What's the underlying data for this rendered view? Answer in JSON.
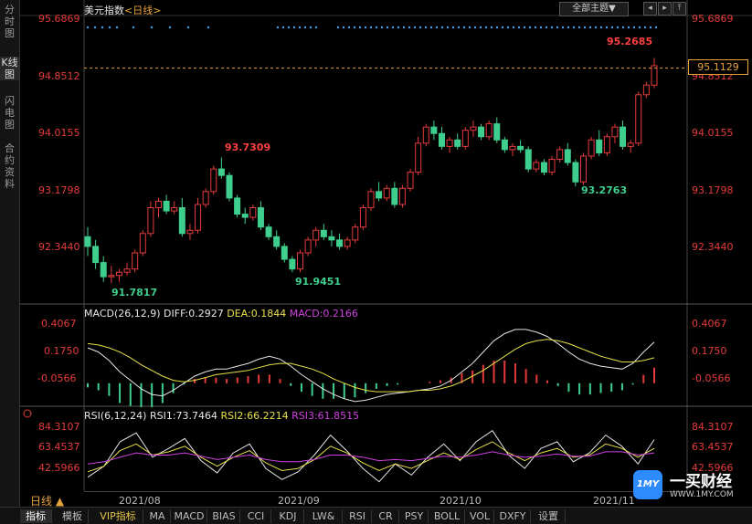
{
  "sidebar": {
    "items": [
      {
        "label": "分时图"
      },
      {
        "label": "K线图"
      },
      {
        "label": "闪电图"
      },
      {
        "label": "合约资料"
      }
    ]
  },
  "header": {
    "name": "美元指数",
    "period_tag": "<日线>",
    "theme_button": "全部主题▼",
    "win_buttons": [
      "◂",
      "▸",
      "⤒"
    ]
  },
  "main_chart": {
    "y_ticks": [
      "95.6869",
      "94.8512",
      "94.0155",
      "93.1798",
      "92.3440"
    ],
    "current_price": "95.1129",
    "annotations": {
      "high_recent": "95.2685",
      "peak_aug": "93.7309",
      "low_jul": "91.7817",
      "low_sep": "91.9451",
      "low_oct": "93.2763"
    }
  },
  "macd": {
    "label": "MACD(26,12,9)",
    "diff": "DIFF:0.2927",
    "dea": "DEA:0.1844",
    "macd": "MACD:0.2166",
    "y_ticks": [
      "0.4067",
      "0.1750",
      "-0.0566"
    ]
  },
  "rsi": {
    "label": "RSI(6,12,24)",
    "rsi1": "RSI1:73.7464",
    "rsi2": "RSI2:66.2214",
    "rsi3": "RSI3:61.8515",
    "y_ticks": [
      "84.3107",
      "63.4537",
      "42.5966"
    ]
  },
  "xaxis": {
    "labels": [
      "2021/08",
      "2021/09",
      "2021/10",
      "2021/11"
    ]
  },
  "period_label": "日线 ▲",
  "bottom_tabs": [
    "指标",
    "模板",
    "VIP指标",
    "MA",
    "MACD",
    "BIAS",
    "CCI",
    "KDJ",
    "LW&",
    "RSI",
    "CR",
    "PSY",
    "BOLL",
    "VOL",
    "DXFY",
    "设置"
  ],
  "logo": {
    "badge": "1MY",
    "text": "一买财经",
    "url": "WWW.1MY.COM"
  },
  "colors": {
    "up": "#e53b3b",
    "down": "#3ecf8e",
    "accent": "#e6a23c"
  },
  "chart_data": [
    {
      "type": "candlestick",
      "title": "美元指数 <日线>",
      "ylim": [
        91.5,
        95.9
      ],
      "x": [
        "2021/08",
        "2021/09",
        "2021/10",
        "2021/11"
      ],
      "candles": [
        [
          92.5,
          92.65,
          92.2,
          92.35
        ],
        [
          92.35,
          92.45,
          92.0,
          92.1
        ],
        [
          92.1,
          92.2,
          91.8,
          91.88
        ],
        [
          91.88,
          92.05,
          91.78,
          91.9
        ],
        [
          91.9,
          92.0,
          91.8,
          91.95
        ],
        [
          91.95,
          92.1,
          91.9,
          92.0
        ],
        [
          92.0,
          92.3,
          91.95,
          92.25
        ],
        [
          92.25,
          92.6,
          92.2,
          92.55
        ],
        [
          92.55,
          93.05,
          92.5,
          92.95
        ],
        [
          92.95,
          93.1,
          92.8,
          93.05
        ],
        [
          93.05,
          93.15,
          92.85,
          92.9
        ],
        [
          92.9,
          93.05,
          92.85,
          92.95
        ],
        [
          92.95,
          93.1,
          92.5,
          92.55
        ],
        [
          92.55,
          92.7,
          92.45,
          92.6
        ],
        [
          92.6,
          93.1,
          92.55,
          93.0
        ],
        [
          93.0,
          93.25,
          92.95,
          93.2
        ],
        [
          93.2,
          93.6,
          93.15,
          93.55
        ],
        [
          93.55,
          93.73,
          93.4,
          93.45
        ],
        [
          93.45,
          93.5,
          93.05,
          93.1
        ],
        [
          93.1,
          93.15,
          92.8,
          92.85
        ],
        [
          92.85,
          92.95,
          92.7,
          92.8
        ],
        [
          92.8,
          93.0,
          92.75,
          92.95
        ],
        [
          92.95,
          93.05,
          92.6,
          92.65
        ],
        [
          92.65,
          92.7,
          92.45,
          92.5
        ],
        [
          92.5,
          92.6,
          92.3,
          92.35
        ],
        [
          92.35,
          92.4,
          92.1,
          92.15
        ],
        [
          92.15,
          92.2,
          91.95,
          92.0
        ],
        [
          92.0,
          92.3,
          91.95,
          92.25
        ],
        [
          92.25,
          92.5,
          92.2,
          92.45
        ],
        [
          92.45,
          92.65,
          92.35,
          92.6
        ],
        [
          92.6,
          92.7,
          92.45,
          92.5
        ],
        [
          92.5,
          92.6,
          92.35,
          92.45
        ],
        [
          92.45,
          92.55,
          92.3,
          92.35
        ],
        [
          92.35,
          92.5,
          92.3,
          92.45
        ],
        [
          92.45,
          92.7,
          92.4,
          92.65
        ],
        [
          92.65,
          93.0,
          92.6,
          92.95
        ],
        [
          92.95,
          93.25,
          92.9,
          93.2
        ],
        [
          93.2,
          93.35,
          93.05,
          93.1
        ],
        [
          93.1,
          93.3,
          93.05,
          93.25
        ],
        [
          93.25,
          93.35,
          92.95,
          93.0
        ],
        [
          93.0,
          93.3,
          92.95,
          93.25
        ],
        [
          93.25,
          93.55,
          93.2,
          93.5
        ],
        [
          93.5,
          94.05,
          93.45,
          93.95
        ],
        [
          93.95,
          94.25,
          93.9,
          94.2
        ],
        [
          94.2,
          94.3,
          94.0,
          94.1
        ],
        [
          94.1,
          94.2,
          93.85,
          93.9
        ],
        [
          93.9,
          94.05,
          93.8,
          94.0
        ],
        [
          94.0,
          94.1,
          93.85,
          93.9
        ],
        [
          93.9,
          94.2,
          93.85,
          94.15
        ],
        [
          94.15,
          94.3,
          94.05,
          94.2
        ],
        [
          94.2,
          94.25,
          94.0,
          94.05
        ],
        [
          94.05,
          94.3,
          94.0,
          94.25
        ],
        [
          94.25,
          94.35,
          93.95,
          94.0
        ],
        [
          94.0,
          94.05,
          93.8,
          93.85
        ],
        [
          93.85,
          93.95,
          93.75,
          93.9
        ],
        [
          93.9,
          94.0,
          93.8,
          93.85
        ],
        [
          93.85,
          93.9,
          93.5,
          93.55
        ],
        [
          93.55,
          93.7,
          93.5,
          93.65
        ],
        [
          93.65,
          93.7,
          93.45,
          93.5
        ],
        [
          93.5,
          93.75,
          93.45,
          93.7
        ],
        [
          93.7,
          93.9,
          93.65,
          93.85
        ],
        [
          93.85,
          93.95,
          93.6,
          93.65
        ],
        [
          93.65,
          93.7,
          93.28,
          93.35
        ],
        [
          93.35,
          93.8,
          93.3,
          93.75
        ],
        [
          93.75,
          94.05,
          93.7,
          94.0
        ],
        [
          94.0,
          94.15,
          93.75,
          93.8
        ],
        [
          93.8,
          94.1,
          93.75,
          94.05
        ],
        [
          94.05,
          94.25,
          93.95,
          94.2
        ],
        [
          94.2,
          94.3,
          93.85,
          93.9
        ],
        [
          93.9,
          94.0,
          93.8,
          93.95
        ],
        [
          93.95,
          94.75,
          93.9,
          94.7
        ],
        [
          94.7,
          94.9,
          94.65,
          94.85
        ],
        [
          94.85,
          95.27,
          94.8,
          95.15
        ]
      ]
    },
    {
      "type": "line",
      "title": "MACD(26,12,9)",
      "series": [
        {
          "name": "DIFF",
          "values": [
            0.25,
            0.22,
            0.16,
            0.08,
            0.02,
            -0.04,
            -0.08,
            -0.09,
            -0.05,
            0.0,
            0.05,
            0.08,
            0.1,
            0.1,
            0.12,
            0.14,
            0.17,
            0.19,
            0.17,
            0.12,
            0.06,
            0.01,
            -0.04,
            -0.08,
            -0.11,
            -0.13,
            -0.12,
            -0.1,
            -0.08,
            -0.07,
            -0.06,
            -0.05,
            -0.04,
            -0.02,
            0.02,
            0.08,
            0.14,
            0.22,
            0.3,
            0.35,
            0.38,
            0.38,
            0.36,
            0.33,
            0.28,
            0.22,
            0.17,
            0.14,
            0.12,
            0.11,
            0.1,
            0.14,
            0.22,
            0.29
          ]
        },
        {
          "name": "DEA",
          "values": [
            0.28,
            0.27,
            0.25,
            0.22,
            0.18,
            0.13,
            0.09,
            0.05,
            0.02,
            0.01,
            0.02,
            0.04,
            0.06,
            0.07,
            0.08,
            0.09,
            0.11,
            0.13,
            0.14,
            0.14,
            0.12,
            0.1,
            0.07,
            0.03,
            0.0,
            -0.03,
            -0.05,
            -0.06,
            -0.06,
            -0.06,
            -0.06,
            -0.05,
            -0.05,
            -0.04,
            -0.02,
            0.01,
            0.05,
            0.09,
            0.14,
            0.19,
            0.24,
            0.28,
            0.3,
            0.31,
            0.3,
            0.28,
            0.25,
            0.22,
            0.19,
            0.17,
            0.15,
            0.15,
            0.16,
            0.18
          ]
        },
        {
          "name": "MACD",
          "values": [
            -0.06,
            -0.1,
            -0.18,
            -0.28,
            -0.32,
            -0.34,
            -0.34,
            -0.28,
            -0.14,
            -0.02,
            0.06,
            0.08,
            0.08,
            0.06,
            0.08,
            0.1,
            0.12,
            0.12,
            0.06,
            -0.04,
            -0.12,
            -0.18,
            -0.22,
            -0.22,
            -0.22,
            -0.2,
            -0.14,
            -0.08,
            -0.04,
            -0.02,
            0.0,
            0.0,
            0.02,
            0.04,
            0.08,
            0.14,
            0.18,
            0.26,
            0.32,
            0.32,
            0.28,
            0.2,
            0.12,
            0.04,
            -0.04,
            -0.12,
            -0.16,
            -0.16,
            -0.14,
            -0.12,
            -0.1,
            -0.02,
            0.12,
            0.22
          ]
        }
      ],
      "ylim": [
        -0.15,
        0.45
      ]
    },
    {
      "type": "line",
      "title": "RSI(6,12,24)",
      "series": [
        {
          "name": "RSI1",
          "values": [
            40,
            50,
            72,
            80,
            58,
            66,
            75,
            55,
            44,
            62,
            70,
            48,
            38,
            45,
            60,
            78,
            64,
            48,
            36,
            52,
            42,
            58,
            70,
            55,
            72,
            82,
            60,
            48,
            66,
            72,
            54,
            62,
            78,
            68,
            52,
            74
          ]
        },
        {
          "name": "RSI2",
          "values": [
            45,
            50,
            64,
            70,
            60,
            63,
            68,
            58,
            50,
            58,
            64,
            53,
            46,
            48,
            56,
            68,
            62,
            53,
            46,
            52,
            48,
            55,
            62,
            56,
            65,
            72,
            62,
            55,
            62,
            66,
            58,
            60,
            70,
            66,
            58,
            66
          ]
        },
        {
          "name": "RSI3",
          "values": [
            52,
            54,
            58,
            62,
            60,
            60,
            62,
            59,
            56,
            58,
            60,
            56,
            54,
            54,
            56,
            60,
            60,
            58,
            55,
            56,
            55,
            57,
            59,
            58,
            60,
            63,
            60,
            58,
            59,
            61,
            59,
            59,
            63,
            63,
            60,
            62
          ]
        }
      ],
      "ylim": [
        30,
        90
      ]
    }
  ]
}
